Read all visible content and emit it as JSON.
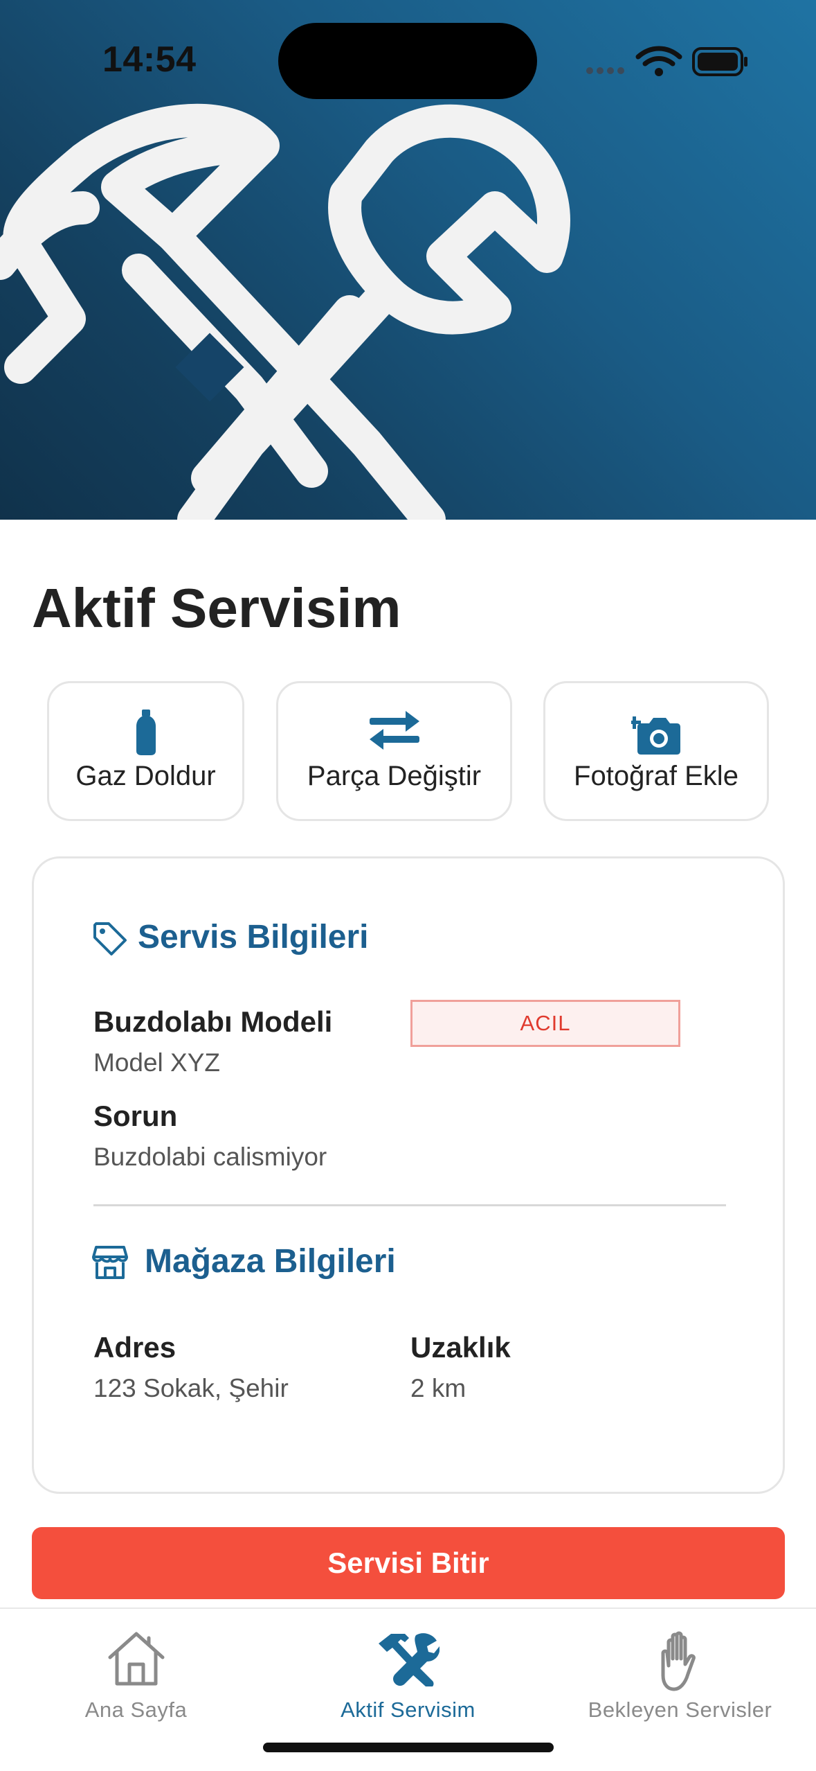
{
  "status_bar": {
    "time": "14:54"
  },
  "page": {
    "title": "Aktif Servisim"
  },
  "actions": [
    {
      "label": "Gaz Doldur",
      "icon": "gas-cylinder-icon"
    },
    {
      "label": "Parça Değiştir",
      "icon": "swap-arrows-icon"
    },
    {
      "label": "Fotoğraf Ekle",
      "icon": "camera-plus-icon"
    }
  ],
  "service_info": {
    "title": "Servis Bilgileri",
    "model_label": "Buzdolabı Modeli",
    "model_value": "Model XYZ",
    "priority_badge": "ACIL",
    "problem_label": "Sorun",
    "problem_value": "Buzdolabi calismiyor"
  },
  "store_info": {
    "title": "Mağaza Bilgileri",
    "address_label": "Adres",
    "address_value": "123 Sokak, Şehir",
    "distance_label": "Uzaklık",
    "distance_value": "2 km"
  },
  "finish_button": {
    "label": "Servisi Bitir"
  },
  "tabs": [
    {
      "label": "Ana Sayfa",
      "icon": "home-icon",
      "active": false
    },
    {
      "label": "Aktif Servisim",
      "icon": "tools-icon",
      "active": true
    },
    {
      "label": "Bekleyen Servisler",
      "icon": "hand-icon",
      "active": false
    }
  ],
  "colors": {
    "primary": "#1c6a98",
    "title_blue": "#1c5f8f",
    "danger": "#f44f3d",
    "badge_text": "#e03a2e",
    "hero_gradient_light": "#1f73a3",
    "hero_gradient_dark": "#10324b"
  }
}
